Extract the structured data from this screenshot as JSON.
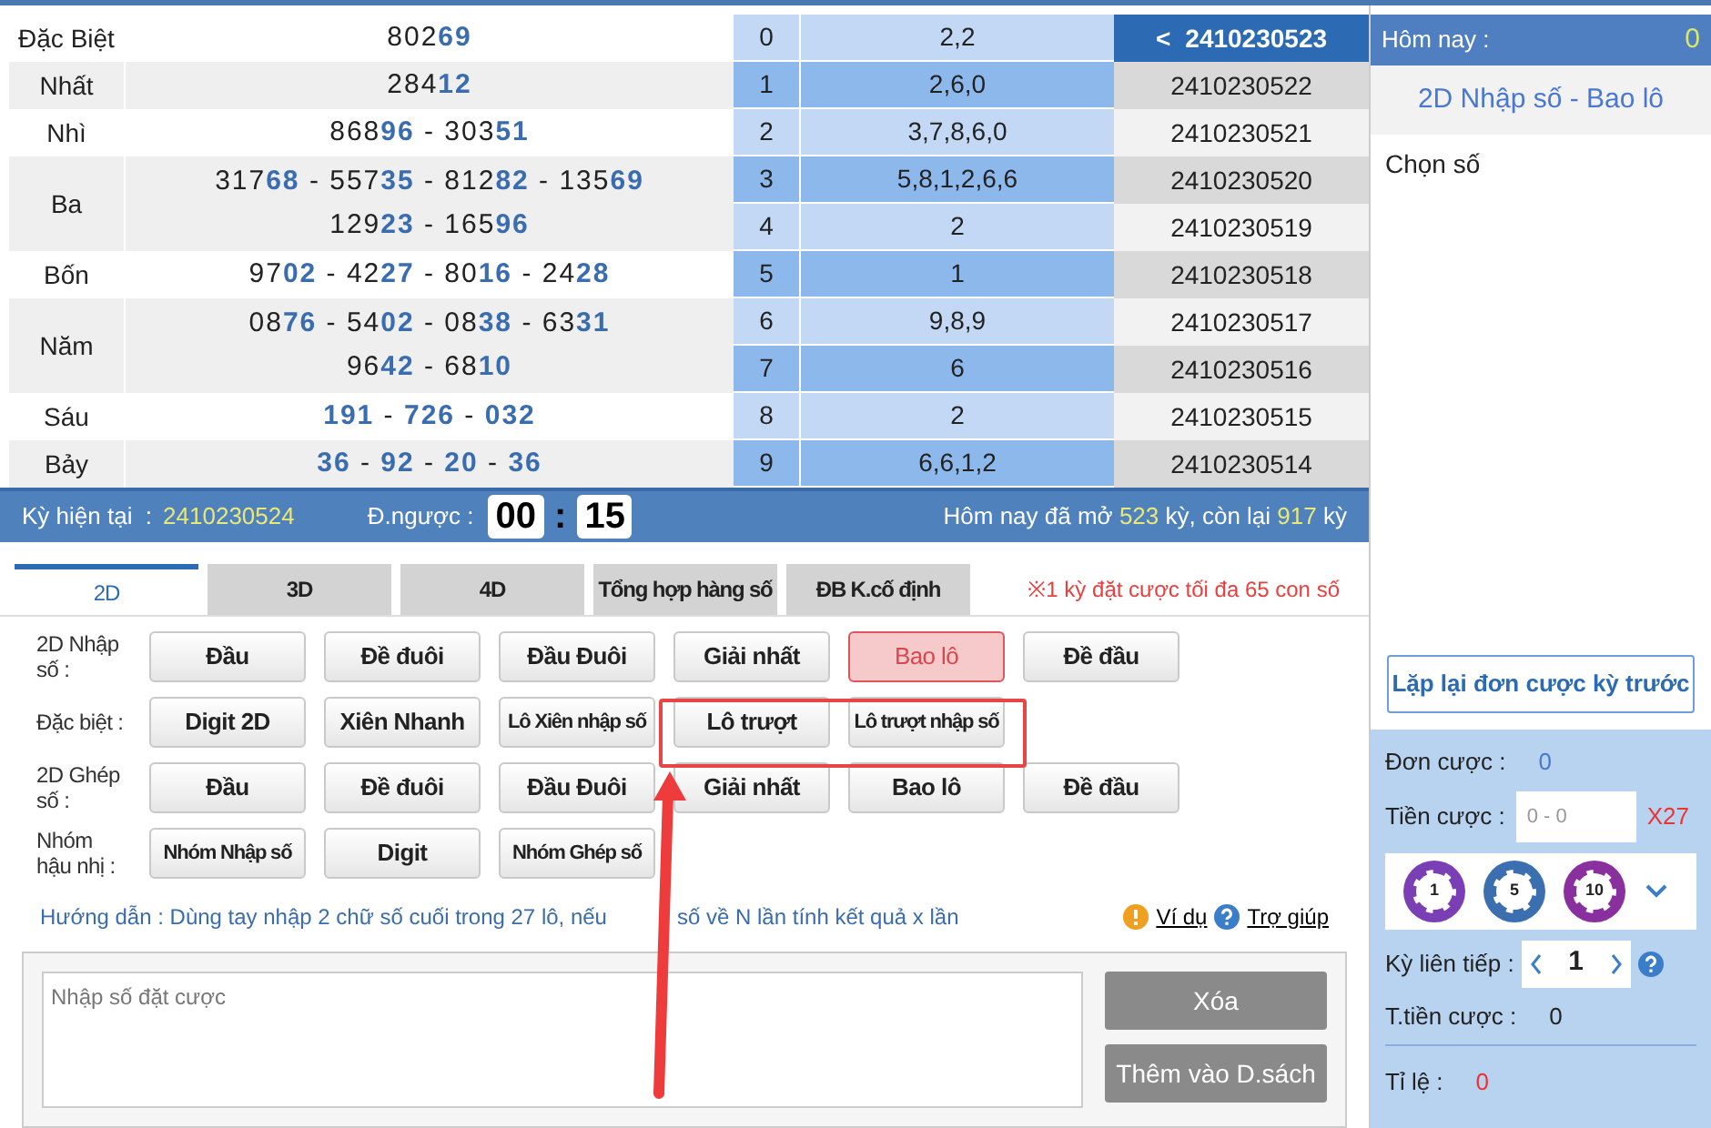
{
  "results": [
    {
      "label": "Đặc Biệt",
      "lines": [
        "802**69**"
      ]
    },
    {
      "label": "Nhất",
      "lines": [
        "284**12**"
      ]
    },
    {
      "label": "Nhì",
      "lines": [
        "868**96** - 303**51**"
      ]
    },
    {
      "label": "Ba",
      "lines": [
        "317**68** - 557**35** - 812**82** - 135**69**",
        "129**23** - 165**96**"
      ]
    },
    {
      "label": "Bốn",
      "lines": [
        "97**02** - 42**27** - 80**16** - 24**28**"
      ]
    },
    {
      "label": "Năm",
      "lines": [
        "08**76** - 54**02** - 08**38** - 63**31**",
        "96**42** - 68**10**"
      ]
    },
    {
      "label": "Sáu",
      "lines": [
        "**191** - **726** - **032**"
      ]
    },
    {
      "label": "Bảy",
      "lines": [
        "**36** - **92** - **20** - **36**"
      ]
    }
  ],
  "digits": [
    {
      "digit": "0",
      "values": "2,2"
    },
    {
      "digit": "1",
      "values": "2,6,0"
    },
    {
      "digit": "2",
      "values": "3,7,8,6,0"
    },
    {
      "digit": "3",
      "values": "5,8,1,2,6,6"
    },
    {
      "digit": "4",
      "values": "2"
    },
    {
      "digit": "5",
      "values": "1"
    },
    {
      "digit": "6",
      "values": "9,8,9"
    },
    {
      "digit": "7",
      "values": "6"
    },
    {
      "digit": "8",
      "values": "2"
    },
    {
      "digit": "9",
      "values": "6,6,1,2"
    }
  ],
  "periods": {
    "current": {
      "arrow": "<",
      "label": "2410230523"
    },
    "items": [
      "2410230522",
      "2410230521",
      "2410230520",
      "2410230519",
      "2410230518",
      "2410230517",
      "2410230516",
      "2410230515",
      "2410230514"
    ]
  },
  "status_bar": {
    "period_label": "Kỳ hiện tại  :",
    "period": "2410230524",
    "countdown_label": "Đ.ngược :",
    "minutes": "00",
    "separator": ":",
    "seconds": "15",
    "summary": "Hôm nay đã mở **523** kỳ, còn lại **917** kỳ"
  },
  "tabs": [
    {
      "label": "2D",
      "selected": true
    },
    {
      "label": "3D",
      "selected": false
    },
    {
      "label": "4D",
      "selected": false
    },
    {
      "label": "Tổng hợp hàng số",
      "selected": false
    },
    {
      "label": "ĐB K.cố định",
      "selected": false
    }
  ],
  "notice": "※1 kỳ đặt cược tối đa 65 con số",
  "bet_rows": [
    {
      "label": "2D Nhập số :",
      "buttons": [
        {
          "label": "Đầu",
          "selected": false
        },
        {
          "label": "Đề đuôi",
          "selected": false
        },
        {
          "label": "Đầu Đuôi",
          "selected": false
        },
        {
          "label": "Giải nhất",
          "selected": false
        },
        {
          "label": "Bao lô",
          "selected": true
        },
        {
          "label": "Đề đầu",
          "selected": false
        }
      ]
    },
    {
      "label": "Đặc biệt :",
      "buttons": [
        {
          "label": "Digit 2D",
          "selected": false
        },
        {
          "label": "Xiên Nhanh",
          "selected": false
        },
        {
          "label": "Lô Xiên nhập số",
          "selected": false
        },
        {
          "label": "Lô trượt",
          "selected": false
        },
        {
          "label": "Lô trượt nhập số",
          "selected": false
        }
      ]
    },
    {
      "label": "2D Ghép số :",
      "buttons": [
        {
          "label": "Đầu",
          "selected": false
        },
        {
          "label": "Đề đuôi",
          "selected": false
        },
        {
          "label": "Đầu Đuôi",
          "selected": false
        },
        {
          "label": "Giải nhất",
          "selected": false
        },
        {
          "label": "Bao lô",
          "selected": false
        },
        {
          "label": "Đề đầu",
          "selected": false
        }
      ]
    },
    {
      "label": "Nhóm hậu nhị :",
      "buttons": [
        {
          "label": "Nhóm Nhập số",
          "selected": false
        },
        {
          "label": "Digit",
          "selected": false
        },
        {
          "label": "Nhóm Ghép số",
          "selected": false
        }
      ]
    }
  ],
  "guide": [
    "Hướng dẫn : Dùng tay nhập 2 chữ số cuối trong 27 lô, nếu",
    "số về N lần tính kết quả x lần"
  ],
  "links": {
    "example": "Ví dụ",
    "help": "Trợ giúp"
  },
  "entry": {
    "placeholder": "Nhập số đặt cược",
    "buttons": [
      "Xóa",
      "Thêm vào D.sách"
    ]
  },
  "sidebar": {
    "today_label": "Hôm nay :",
    "today_value": "0",
    "mode": "2D Nhập số - Bao lô",
    "pick_label": "Chọn số",
    "repeat_button": "Lặp lại đơn cược kỳ trước",
    "orders_label": "Đơn cược :",
    "orders_value": "0",
    "amount_label": "Tiền cược :",
    "amount_placeholder": "0 - 0",
    "multiplier": "X27",
    "chips": [
      {
        "value": "1",
        "color": "#7b3fb5"
      },
      {
        "value": "5",
        "color": "#3c6fb0"
      },
      {
        "value": "10",
        "color": "#8a2f9e"
      }
    ],
    "streak_label": "Kỳ liên tiếp :",
    "streak_value": "1",
    "total_label": "T.tiền cược :",
    "total_value": "0",
    "ratio_label": "Tỉ lệ :",
    "ratio_value": "0"
  }
}
